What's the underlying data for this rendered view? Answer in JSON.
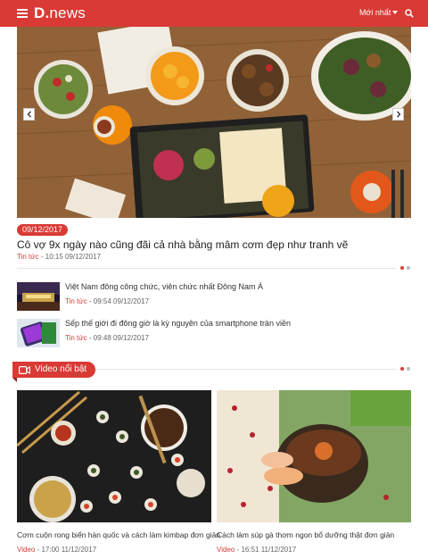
{
  "header": {
    "logo_mark": "D.",
    "logo_text": "news",
    "sort_label": "Mới nhất",
    "brand_color": "#d93a35"
  },
  "hero": {
    "date": "09/12/2017",
    "title": "Cô vợ 9x ngày nào cũng đãi cả nhà bằng mâm cơm đẹp như tranh vẽ",
    "category": "Tin tức",
    "time": "- 10:15 09/12/2017"
  },
  "news_list": [
    {
      "title": "Việt Nam đông công chức, viên chức nhất Đông Nam Á",
      "category": "Tin tức",
      "time": "- 09:54 09/12/2017"
    },
    {
      "title": "Sếp thế giới đi đông giờ là kỳ nguyên của smartphone tràn viền",
      "category": "Tin tức",
      "time": "- 09:48 09/12/2017"
    }
  ],
  "video_section": {
    "title": "Video nổi bật",
    "items": [
      {
        "title": "Cơm cuộn rong biển hàn quốc và cách làm kimbap đơn giản",
        "category": "Video",
        "time": "- 17:00 11/12/2017"
      },
      {
        "title": "Cách làm súp gà thơm ngon bổ dưỡng thật đơn giản",
        "category": "Video",
        "time": "- 16:51 11/12/2017"
      }
    ]
  }
}
